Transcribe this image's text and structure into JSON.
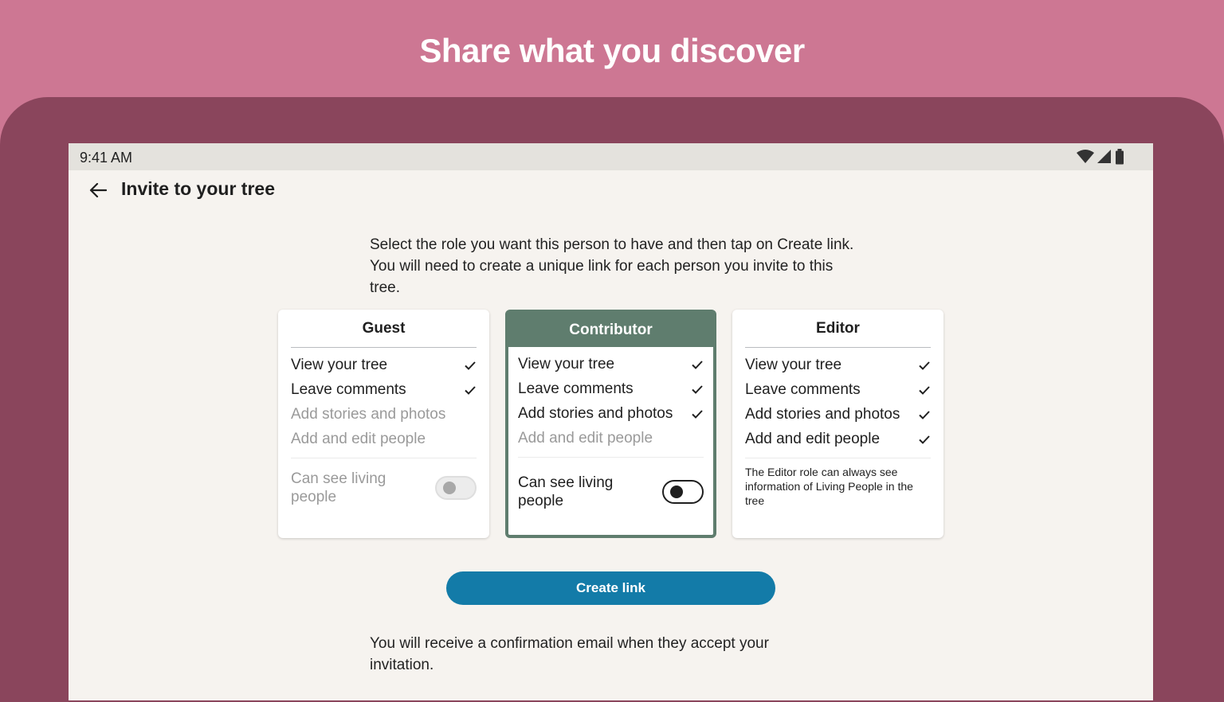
{
  "banner": {
    "title": "Share what you discover"
  },
  "status_bar": {
    "time": "9:41 AM",
    "icons": [
      "wifi-icon",
      "cell-signal-icon",
      "battery-icon"
    ]
  },
  "app_bar": {
    "back_icon": "arrow-left-icon",
    "title": "Invite to your tree"
  },
  "intro_text": "Select the role you want this person to have and then tap on Create link. You will need to create a unique link for each person you invite to this tree.",
  "roles": [
    {
      "name": "Guest",
      "selected": false,
      "permissions": [
        {
          "label": "View your tree",
          "enabled": true
        },
        {
          "label": "Leave comments",
          "enabled": true
        },
        {
          "label": "Add stories and photos",
          "enabled": false
        },
        {
          "label": "Add and edit people",
          "enabled": false
        }
      ],
      "toggle": {
        "label": "Can see living people",
        "state": "off",
        "disabled": true
      }
    },
    {
      "name": "Contributor",
      "selected": true,
      "permissions": [
        {
          "label": "View your tree",
          "enabled": true
        },
        {
          "label": "Leave comments",
          "enabled": true
        },
        {
          "label": "Add stories and photos",
          "enabled": true
        },
        {
          "label": "Add and edit people",
          "enabled": false
        }
      ],
      "toggle": {
        "label": "Can see living people",
        "state": "off",
        "disabled": false
      }
    },
    {
      "name": "Editor",
      "selected": false,
      "permissions": [
        {
          "label": "View your tree",
          "enabled": true
        },
        {
          "label": "Leave comments",
          "enabled": true
        },
        {
          "label": "Add stories and photos",
          "enabled": true
        },
        {
          "label": "Add and edit people",
          "enabled": true
        }
      ],
      "note": "The Editor role can always see information of Living People in the tree"
    }
  ],
  "create_button": {
    "label": "Create link"
  },
  "confirmation_text": "You will receive a confirmation email when they accept your invitation.",
  "colors": {
    "banner_bg": "#cd7793",
    "device_frame": "#8a455c",
    "selected_card": "#5f7d6e",
    "primary_button": "#137ba8"
  }
}
